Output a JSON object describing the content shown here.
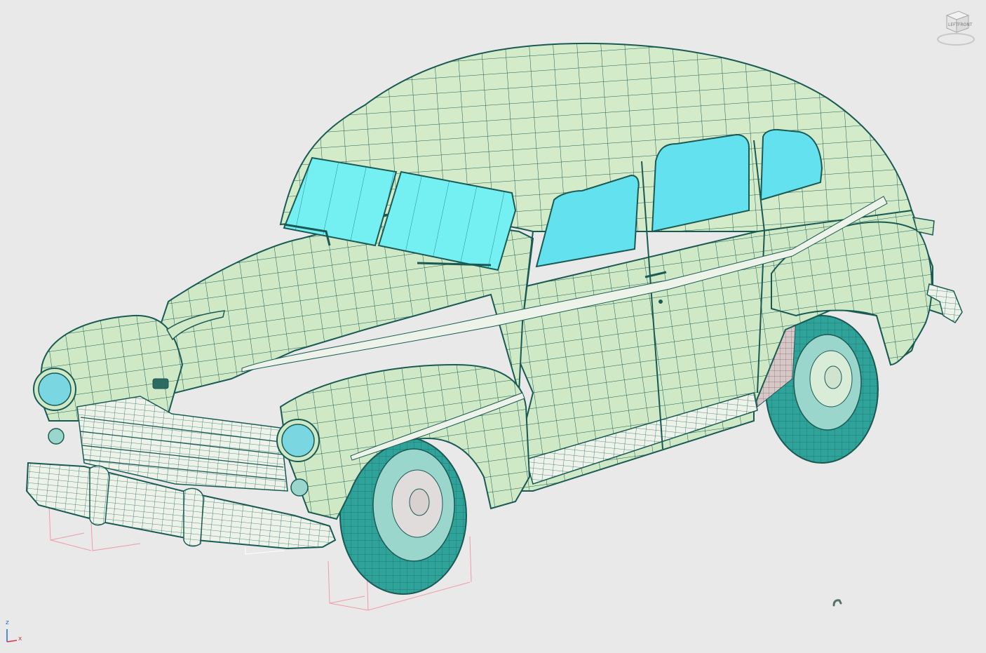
{
  "viewport": {
    "background": "#e9e9e9",
    "model": {
      "body_color": "#cfe9c6",
      "wire_color": "#1f5c55",
      "glass_color": "#63e1ee",
      "tire_color": "#2fa39a",
      "chrome_color": "#eef3ea"
    },
    "viewcube": {
      "faces": {
        "left": "LEFT",
        "front": "FRONT"
      }
    },
    "triad": {
      "z_label": "z",
      "x_label": "x",
      "z_color": "#1a6fcf",
      "x_color": "#d9344a"
    }
  }
}
